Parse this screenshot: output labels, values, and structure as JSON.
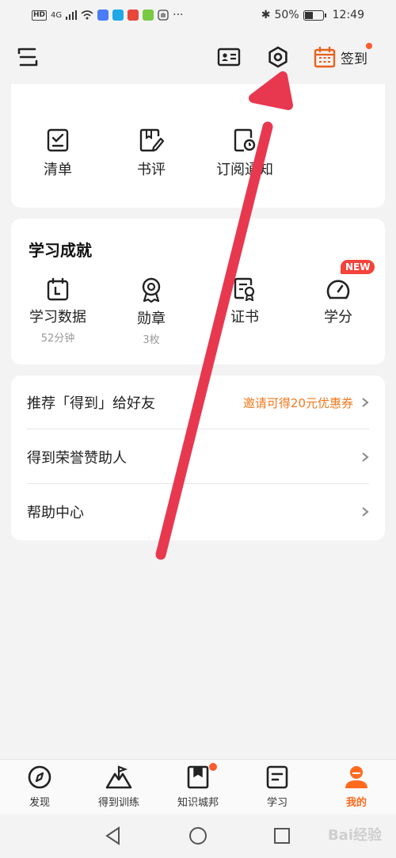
{
  "status_bar": {
    "left_hd": "HD",
    "left_signal": "4G",
    "bluetooth": "✱",
    "battery_percent": "50%",
    "battery_level": 0.5,
    "time": "12:49",
    "more": "···"
  },
  "header": {
    "menu_icon": "menu-icon",
    "id_card_icon": "id-card-icon",
    "settings_icon": "hexagon-settings-icon",
    "checkin_label": "签到"
  },
  "tools": [
    {
      "label": "清单",
      "icon": "checklist-icon"
    },
    {
      "label": "书评",
      "icon": "book-review-icon"
    },
    {
      "label": "订阅通知",
      "icon": "subscription-icon"
    }
  ],
  "achievements": {
    "title": "学习成就",
    "items": [
      {
        "label": "学习数据",
        "sub": "52分钟",
        "icon": "calendar-icon"
      },
      {
        "label": "勋章",
        "sub": "3枚",
        "icon": "medal-icon"
      },
      {
        "label": "证书",
        "sub": "",
        "icon": "certificate-icon"
      },
      {
        "label": "学分",
        "sub": "",
        "icon": "gauge-icon"
      }
    ],
    "new_badge": "NEW"
  },
  "links": [
    {
      "label": "推荐「得到」给好友",
      "extra": "邀请可得20元优惠券"
    },
    {
      "label": "得到荣誉赞助人",
      "extra": ""
    },
    {
      "label": "帮助中心",
      "extra": ""
    }
  ],
  "tabs": [
    {
      "label": "发现",
      "icon": "compass-icon"
    },
    {
      "label": "得到训练",
      "icon": "mountain-flag-icon"
    },
    {
      "label": "知识城邦",
      "icon": "bookmark-book-icon"
    },
    {
      "label": "学习",
      "icon": "document-icon"
    },
    {
      "label": "我的",
      "icon": "user-icon"
    }
  ],
  "colors": {
    "accent": "#ff6a1f",
    "badge_red": "#f3433a",
    "arrow": "#e8384f",
    "invite": "#f0791e"
  },
  "watermark": "Bai经验"
}
